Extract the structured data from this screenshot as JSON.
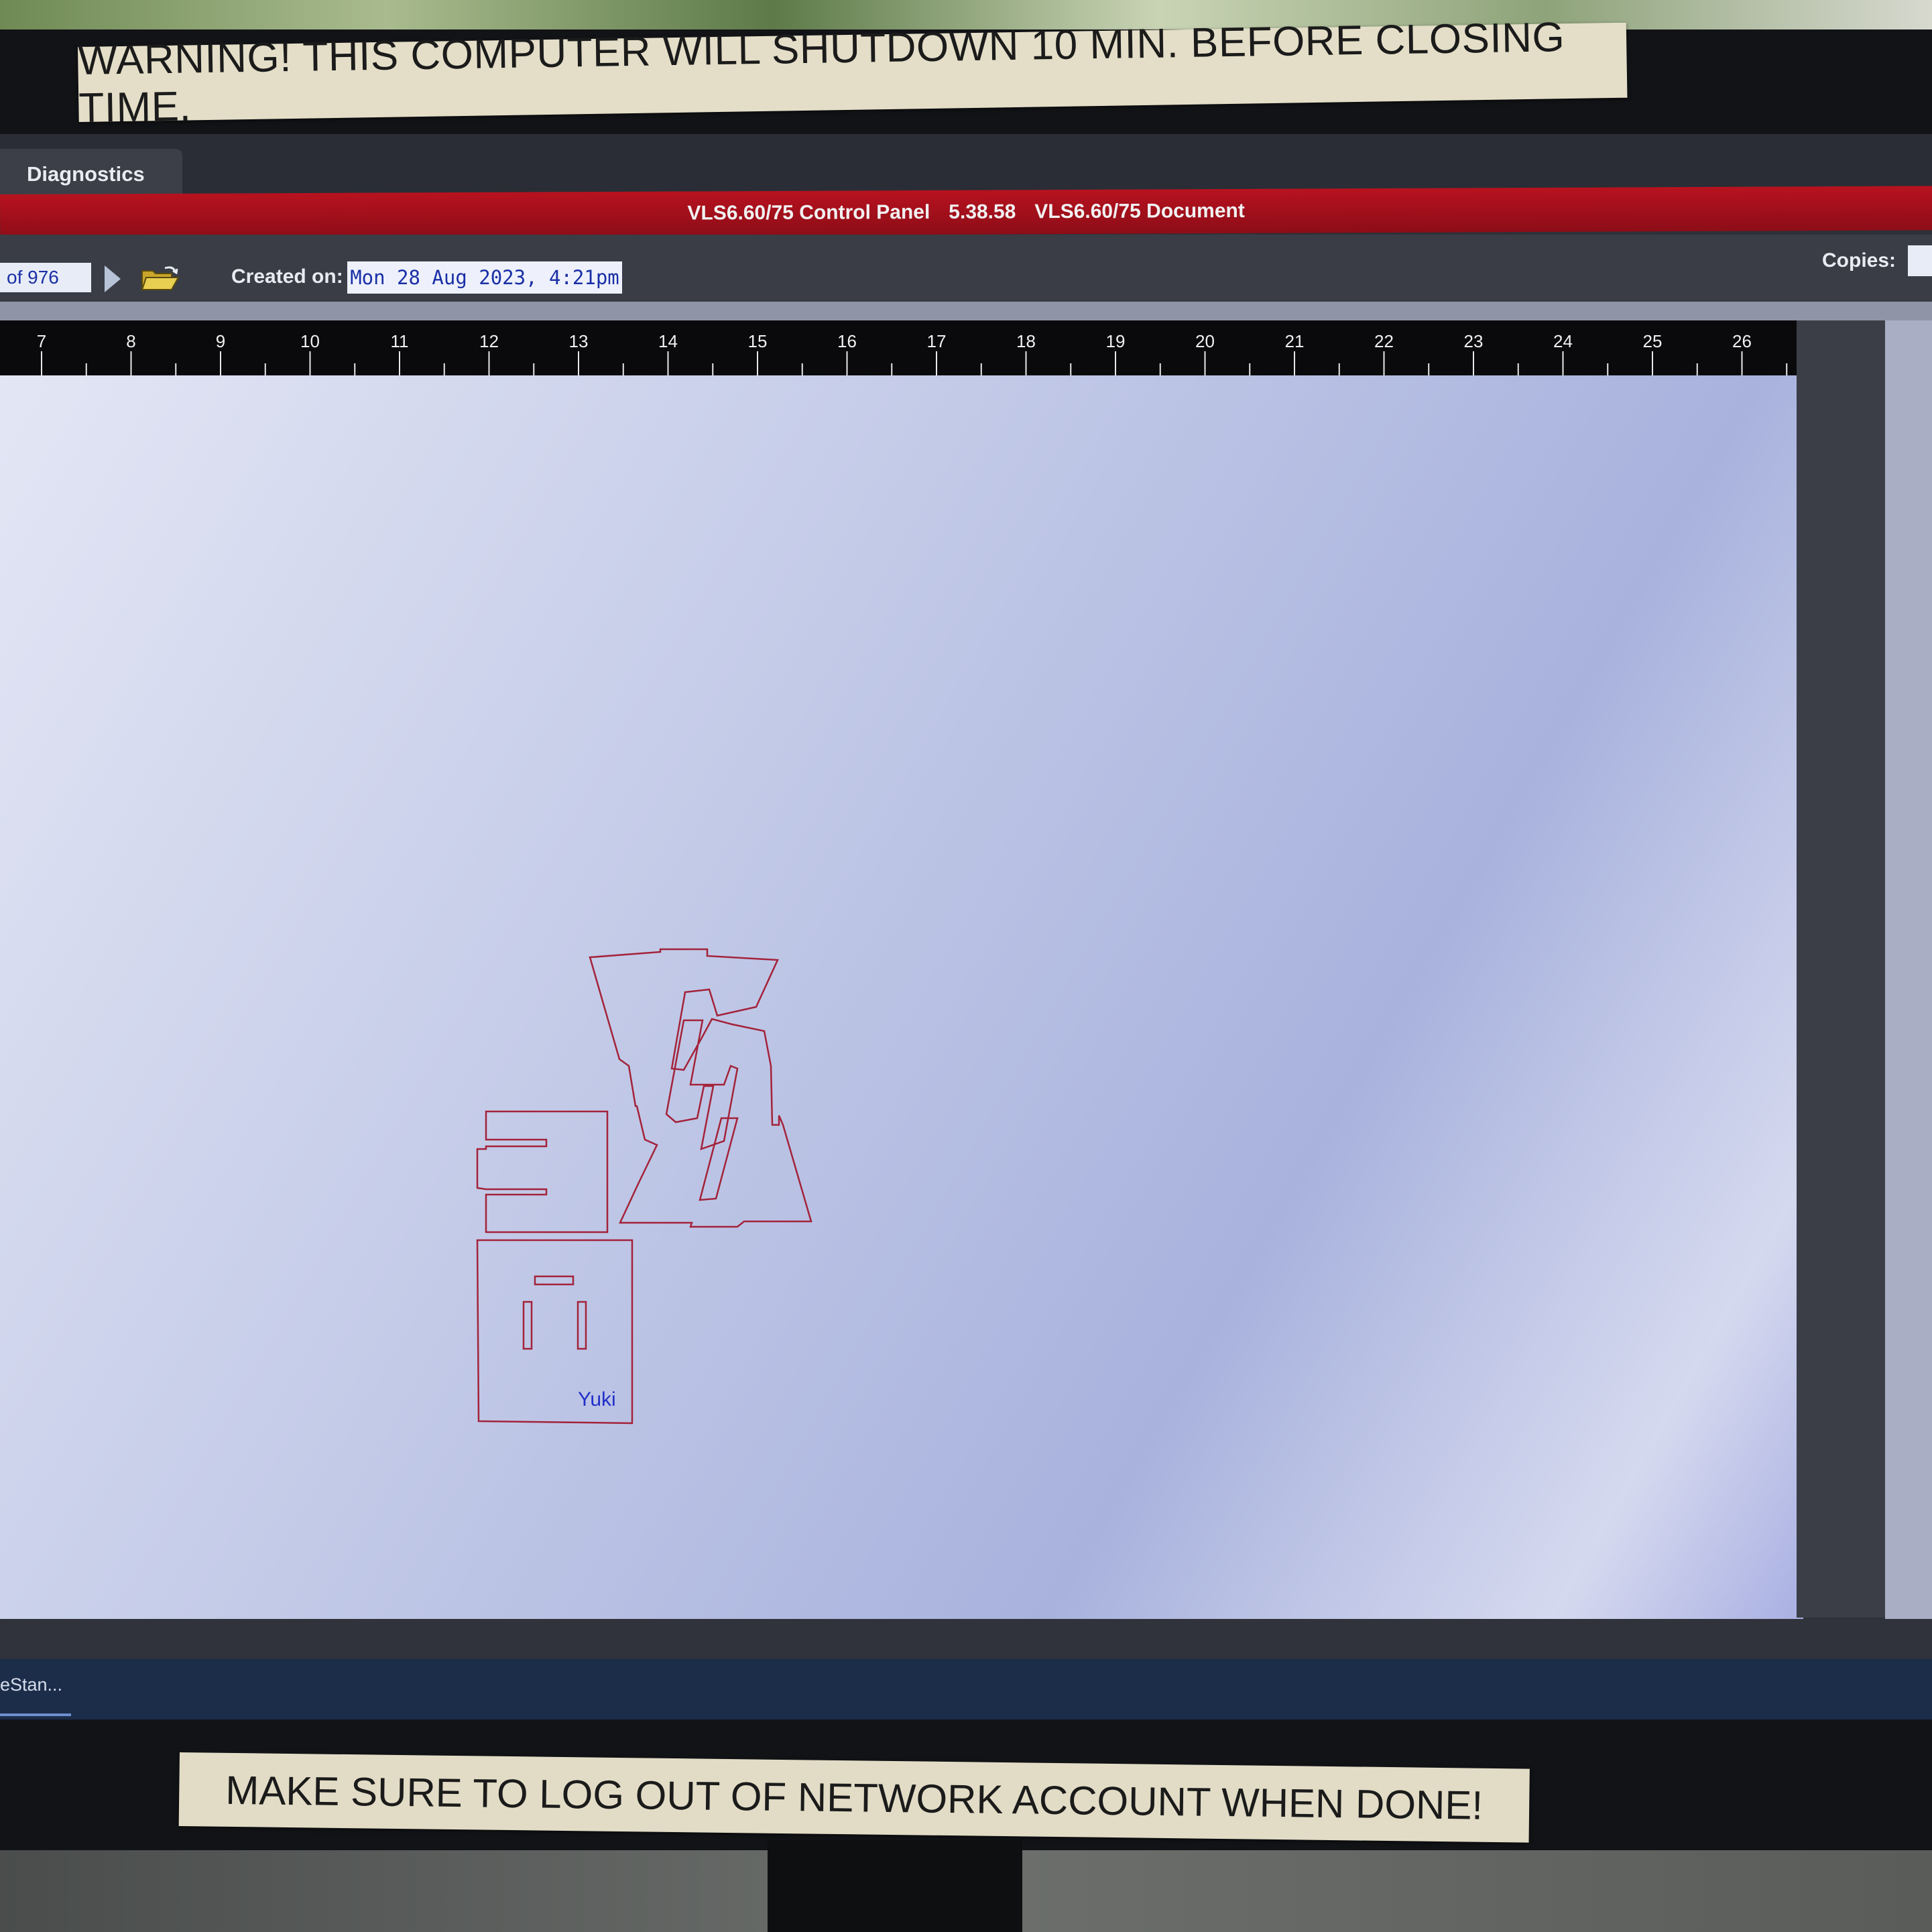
{
  "labels": {
    "warning": "WARNING! THIS COMPUTER WILL SHUTDOWN 10 MIN. BEFORE CLOSING TIME.",
    "logout": "MAKE SURE TO LOG OUT OF NETWORK ACCOUNT WHEN DONE!"
  },
  "tabs": {
    "diagnostics": "Diagnostics"
  },
  "title_bar": {
    "app": "VLS6.60/75  Control Panel",
    "version": "5.38.58",
    "document": "VLS6.60/75 Document"
  },
  "toolbar": {
    "page_counter": "of 976",
    "created_label": "Created on:",
    "created_value": "Mon 28 Aug 2023,  4:21pm",
    "copies_label": "Copies:"
  },
  "ruler": {
    "ticks": [
      "7",
      "8",
      "9",
      "10",
      "11",
      "12",
      "13",
      "14",
      "15",
      "16",
      "17",
      "18",
      "19",
      "20",
      "21",
      "22",
      "23",
      "24",
      "25",
      "26"
    ]
  },
  "canvas": {
    "design_text": "Yuki",
    "cut_color": "#a3233a",
    "text_color": "#2130c9"
  },
  "taskbar": {
    "item": "eStan..."
  },
  "icons": {
    "next": "play-arrow-icon",
    "open": "folder-open-icon"
  }
}
